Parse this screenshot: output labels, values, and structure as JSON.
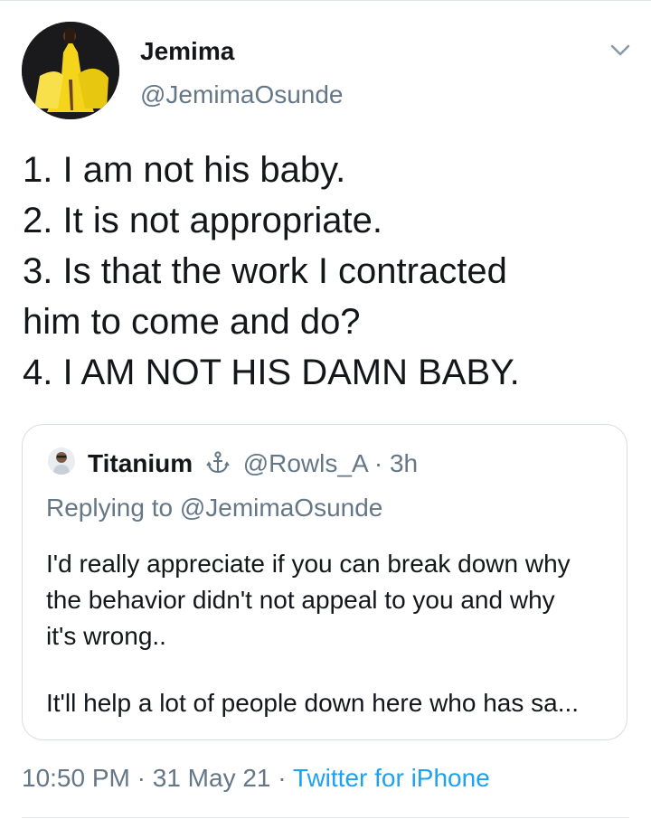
{
  "author": {
    "name": "Jemima",
    "handle": "@JemimaOsunde"
  },
  "tweet": {
    "lines": [
      "1. I am not his baby.",
      "2. It is not appropriate.",
      "3. Is that the work I contracted",
      "him to come and do?",
      "4. I AM NOT HIS DAMN BABY."
    ]
  },
  "quoted": {
    "name": "Titanium",
    "badge_icon": "anchor-icon",
    "handle": "@Rowls_A",
    "separator": "·",
    "time": "3h",
    "replying_to": "Replying to @JemimaOsunde",
    "body_lines": [
      "I'd really appreciate if you can break down why",
      "the behavior didn't not appeal to you and why",
      "it's wrong..",
      "It'll help a lot of people down here who has sa..."
    ]
  },
  "meta": {
    "time": "10:50 PM",
    "separator": "·",
    "date": "31 May 21",
    "source": "Twitter for iPhone"
  },
  "colors": {
    "text": "#14171a",
    "muted": "#657786",
    "link": "#1da1f2",
    "border": "#d7dee3"
  }
}
